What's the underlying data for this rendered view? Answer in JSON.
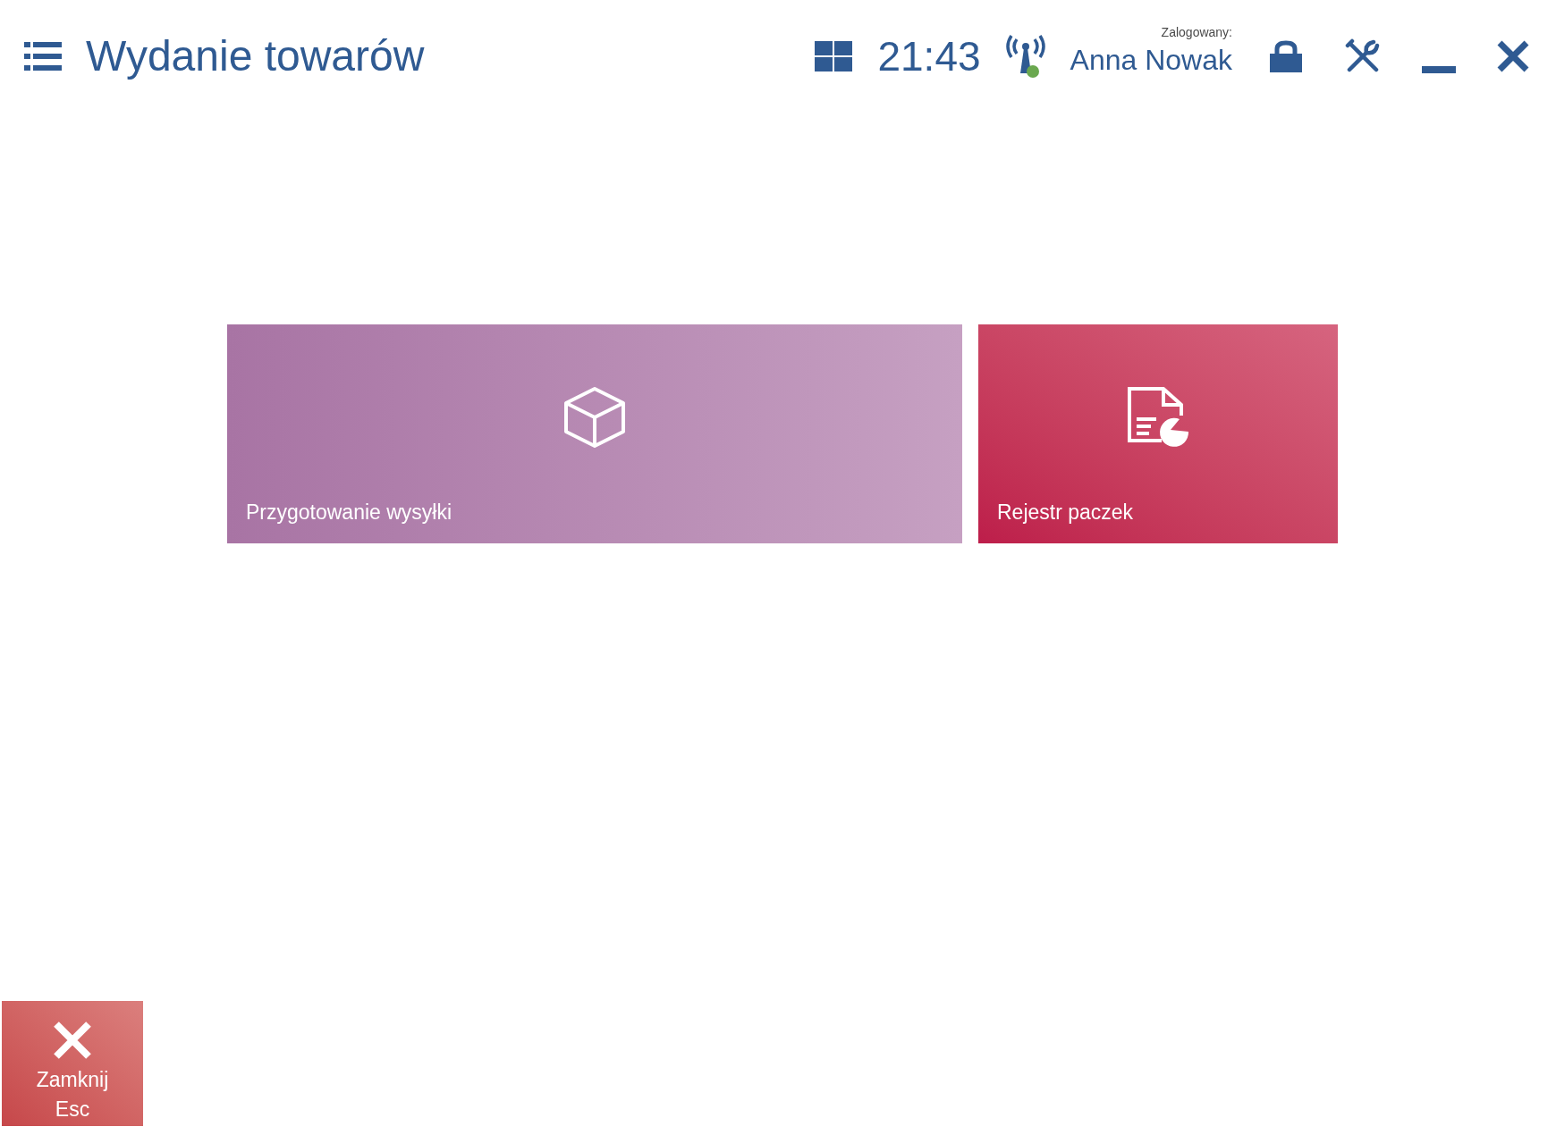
{
  "header": {
    "title": "Wydanie towarów",
    "time": "21:43",
    "user_label": "Zalogowany:",
    "user_name": "Anna Nowak"
  },
  "tiles": [
    {
      "kind": "box",
      "label": "Przygotowanie wysyłki"
    },
    {
      "kind": "document",
      "label": "Rejestr paczek"
    }
  ],
  "close_button": {
    "label": "Zamknij",
    "shortcut": "Esc"
  }
}
